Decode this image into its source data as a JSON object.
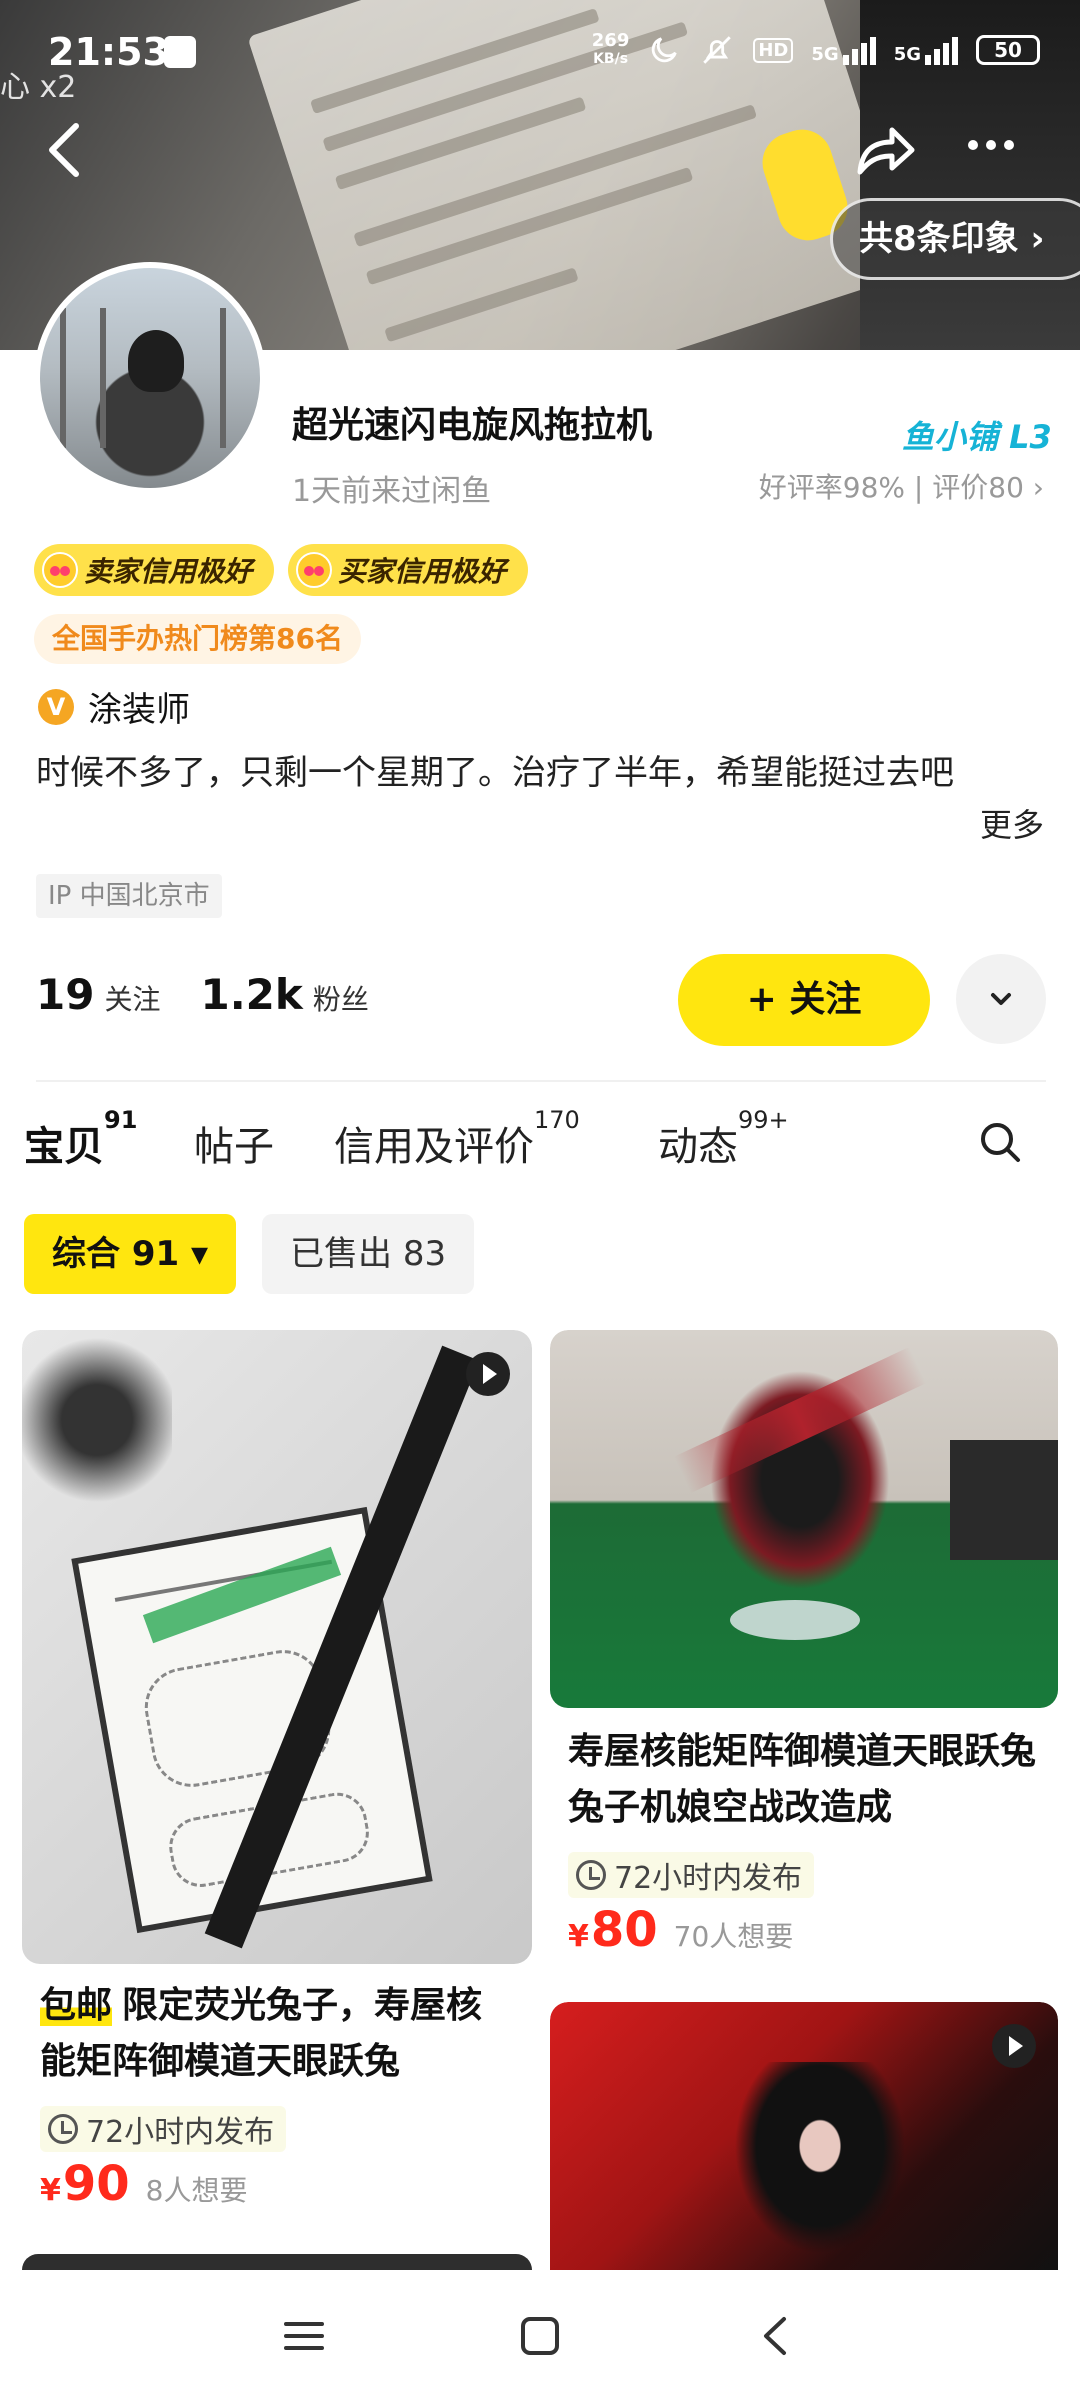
{
  "status_bar": {
    "time": "21:53",
    "speed_value": "269",
    "speed_unit": "KB/s",
    "hd": "HD",
    "net1": "5G",
    "net2": "5G",
    "battery": "50"
  },
  "overlay_text": "心 x2",
  "header": {
    "impressions": "共8条印象 ›"
  },
  "profile": {
    "name": "超光速闪电旋风拖拉机",
    "last_seen": "1天前来过闲鱼",
    "shop_level": "鱼小铺 L3",
    "rating": "好评率98% | 评价80 ›",
    "badges": [
      "卖家信用极好",
      "买家信用极好"
    ],
    "rank": "全国手办热门榜第86名",
    "role": "涂装师",
    "bio": "时候不多了，只剩一个星期了。治疗了半年，希望能挺过去吧",
    "more": "更多",
    "ip": "IP  中国北京市",
    "following_count": "19",
    "following_label": "关注",
    "followers_count": "1.2k",
    "followers_label": "粉丝",
    "follow_button": "+ 关注"
  },
  "tabs": [
    {
      "label": "宝贝",
      "count": "91"
    },
    {
      "label": "帖子",
      "count": ""
    },
    {
      "label": "信用及评价",
      "count": "170"
    },
    {
      "label": "动态",
      "count": "99+"
    }
  ],
  "filters": [
    {
      "label": "综合 91 ▾",
      "active": true
    },
    {
      "label": "已售出 83",
      "active": false
    }
  ],
  "products": [
    {
      "tag": "包邮",
      "title": "限定荧光兔子，寿屋核能矩阵御模道天眼跃兔",
      "time": "72小时内发布",
      "currency": "¥",
      "price": "90",
      "wants": "8人想要"
    },
    {
      "tag": "",
      "title": "寿屋核能矩阵御模道天眼跃兔兔子机娘空战改造成",
      "time": "72小时内发布",
      "currency": "¥",
      "price": "80",
      "wants": "70人想要"
    }
  ],
  "icons": [
    "back-icon",
    "share-icon",
    "more-icon",
    "chevron-down-icon",
    "search-icon",
    "clock-icon",
    "play-icon",
    "menu-icon",
    "home-icon",
    "nav-back-icon"
  ]
}
